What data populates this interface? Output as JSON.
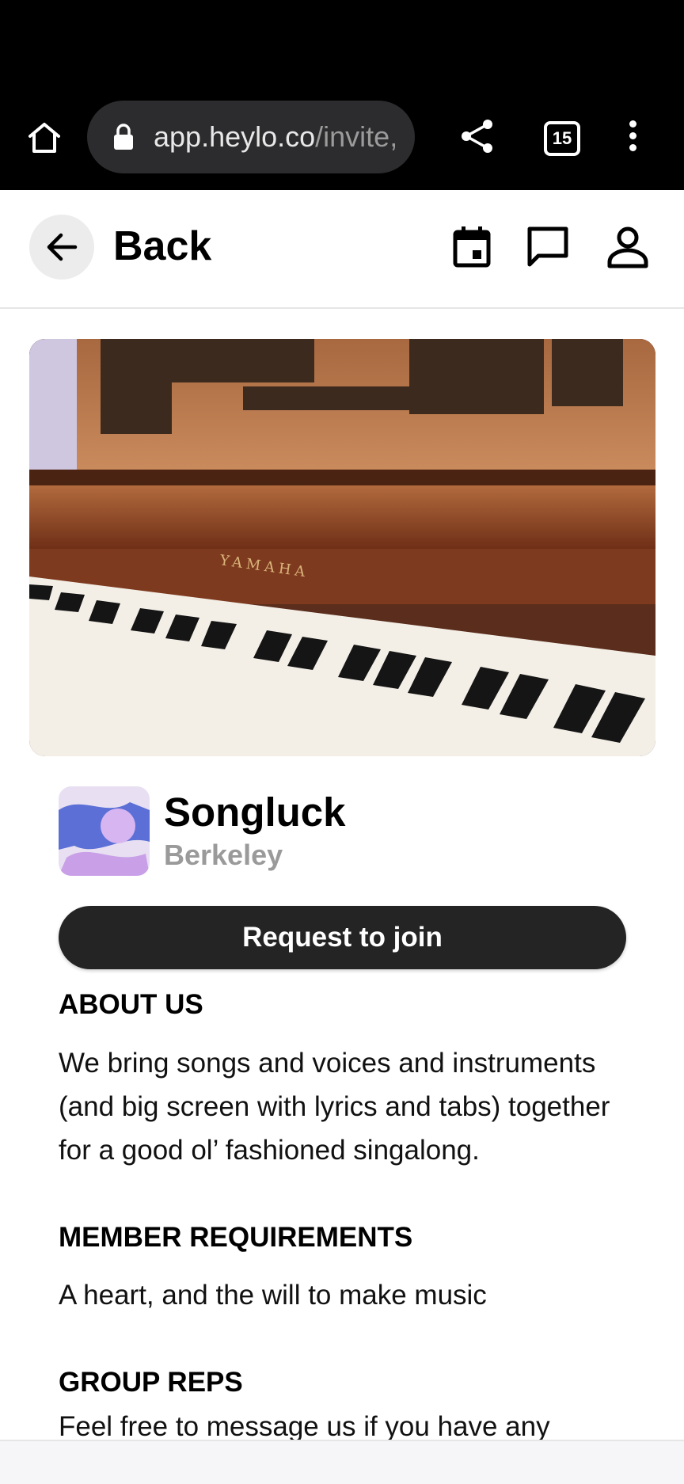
{
  "browser": {
    "url_host": "app.heylo.co",
    "url_path": "/invite,",
    "tab_count": "15",
    "icons": [
      "home-icon",
      "lock-icon",
      "share-icon",
      "tabs-icon",
      "more-vert-icon"
    ]
  },
  "header": {
    "back_label": "Back",
    "icons": [
      "back-arrow-icon",
      "calendar-icon",
      "chat-icon",
      "profile-icon"
    ]
  },
  "group": {
    "name": "Songluck",
    "location": "Berkeley",
    "hero_brand_text": "YAMAHA",
    "join_label": "Request to join"
  },
  "sections": {
    "about_title": "ABOUT US",
    "about_body": "We bring songs and voices and instruments (and big screen with lyrics and tabs) together for a good ol’ fashioned singalong.",
    "requirements_title": "MEMBER REQUIREMENTS",
    "requirements_body": "A heart, and the will to make music",
    "reps_title": "GROUP REPS",
    "reps_body": "Feel free to message us if you have any"
  },
  "colors": {
    "browser_bar": "#000000",
    "join_button": "#242424",
    "location_text": "#9a9a9a"
  }
}
